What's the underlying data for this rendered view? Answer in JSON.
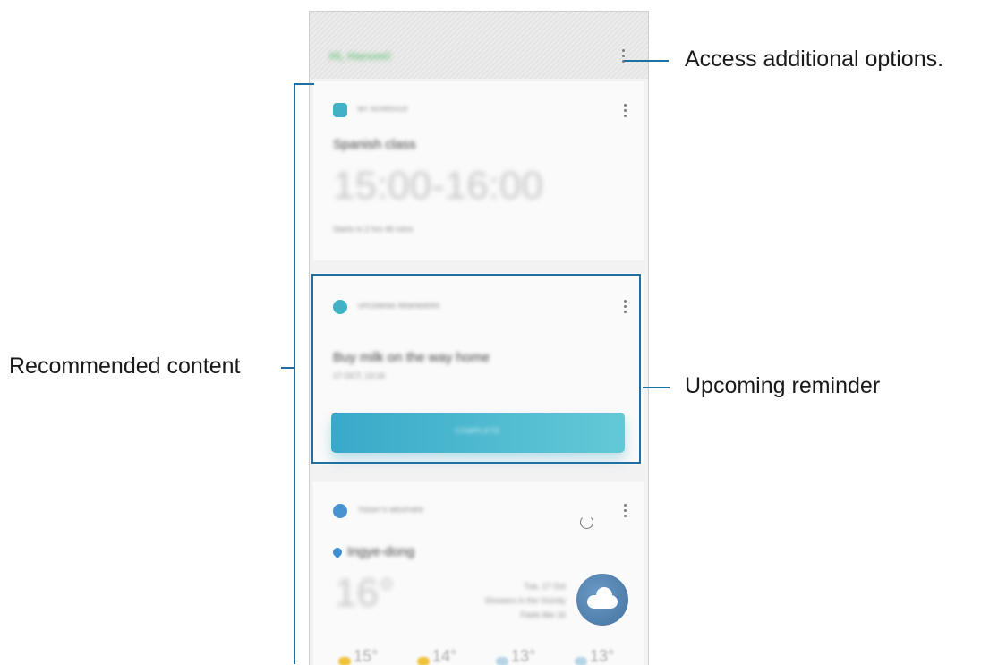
{
  "annotations": {
    "options": "Access additional options.",
    "recommended": "Recommended content",
    "reminder": "Upcoming reminder"
  },
  "header": {
    "greeting": "Hi, Harumi!"
  },
  "schedule_card": {
    "title": "MY SCHEDULE",
    "event": "Spanish class",
    "time": "15:00-16:00",
    "starts": "Starts in 2 hrs 46 mins"
  },
  "reminder_card": {
    "title": "UPCOMING REMINDERS",
    "text": "Buy milk on the way home",
    "date": "17 OCT, 13:16",
    "button": "COMPLETE"
  },
  "weather_card": {
    "title": "TODAY'S WEATHER",
    "location": "Ingye-dong",
    "temp": "16°",
    "date": "Tue, 17 Oct",
    "desc": "Showers in the Vicinity",
    "feels": "Feels like 16",
    "forecast": [
      "15°",
      "14°",
      "13°",
      "13°"
    ]
  },
  "colors": {
    "accent": "#1f6fa3",
    "button_start": "#37a9c9",
    "button_end": "#64c9d6"
  }
}
